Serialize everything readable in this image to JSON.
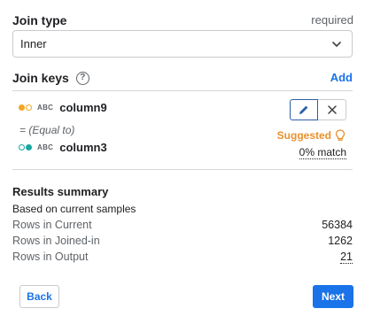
{
  "join_type": {
    "label": "Join type",
    "required_text": "required",
    "selected_value": "Inner"
  },
  "join_keys": {
    "label": "Join keys",
    "help_icon_text": "?",
    "add_label": "Add",
    "left_key": {
      "type_label": "ABC",
      "name": "column9"
    },
    "relation": "= (Equal to)",
    "right_key": {
      "type_label": "ABC",
      "name": "column3"
    },
    "suggested_label": "Suggested",
    "match_text": "0% match"
  },
  "results": {
    "title": "Results summary",
    "subtitle": "Based on current samples",
    "rows": [
      {
        "label": "Rows in Current",
        "value": "56384"
      },
      {
        "label": "Rows in Joined-in",
        "value": "1262"
      },
      {
        "label": "Rows in Output",
        "value": "21"
      }
    ]
  },
  "footer": {
    "back_label": "Back",
    "next_label": "Next"
  },
  "colors": {
    "accent": "#1a73e8",
    "suggested": "#e8912d",
    "left_key_dot": "#f5a623",
    "right_key_dot": "#1aa7a1"
  },
  "icons": {
    "select_caret": "chevron-down-icon",
    "edit": "pencil-icon",
    "remove": "close-icon",
    "suggested": "lightbulb-icon",
    "help": "help-circle-icon"
  }
}
